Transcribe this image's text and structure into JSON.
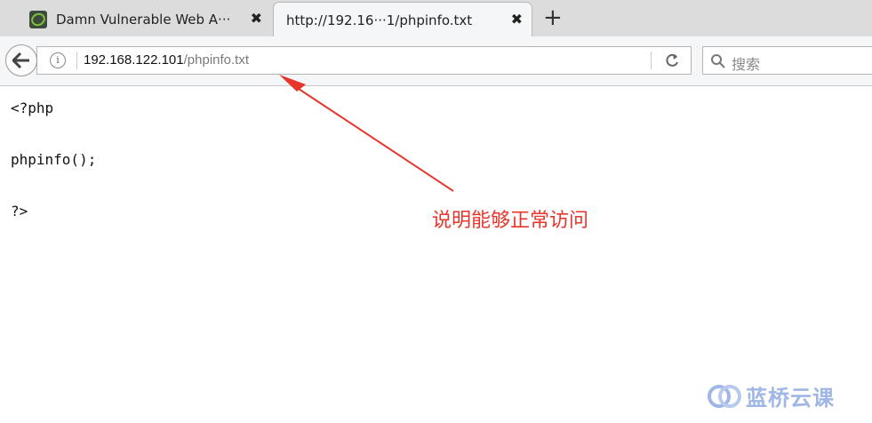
{
  "tabs": [
    {
      "title": "Damn Vulnerable Web A···",
      "active": false
    },
    {
      "title": "http://192.16···1/phpinfo.txt",
      "active": true
    }
  ],
  "tab_close_glyph": "✖",
  "new_tab_glyph": "+",
  "urlbar": {
    "host": "192.168.122.101",
    "path": "/phpinfo.txt"
  },
  "search": {
    "placeholder": "搜索"
  },
  "icons": {
    "back": "back-arrow-icon",
    "info": "info-icon",
    "reload": "reload-icon",
    "search": "search-icon"
  },
  "content": {
    "lines": [
      "<?php",
      "phpinfo();",
      "?>"
    ]
  },
  "annotation": {
    "text": "说明能够正常访问",
    "color": "#e8352c"
  },
  "watermark": {
    "text": "蓝桥云课"
  },
  "colors": {
    "tabstrip": "#dcdcdc",
    "toolbar": "#f5f6f7",
    "annotation": "#e8352c"
  }
}
